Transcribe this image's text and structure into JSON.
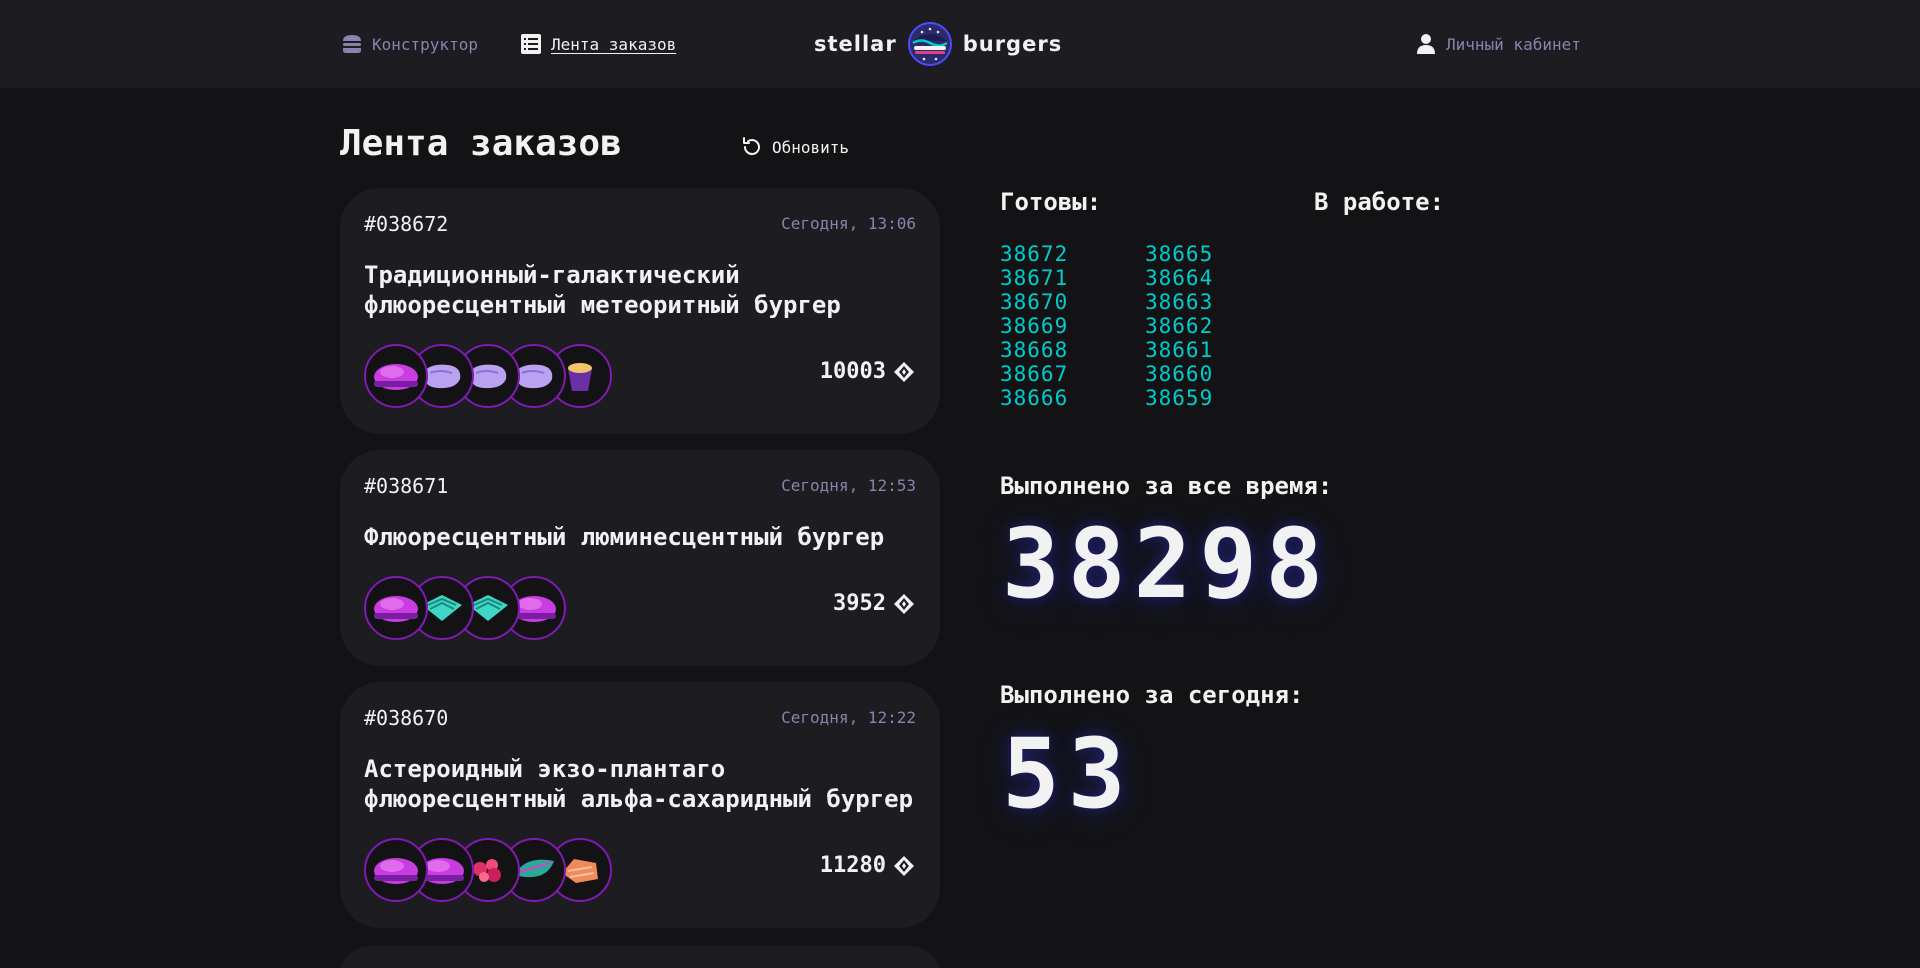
{
  "header": {
    "nav_constructor": "Конструктор",
    "nav_feed": "Лента заказов",
    "logo_left": "stellar",
    "logo_right": "burgers",
    "nav_profile": "Личный кабинет"
  },
  "main": {
    "title": "Лента заказов",
    "refresh_label": "Обновить"
  },
  "orders": [
    {
      "number": "#038672",
      "date": "Сегодня, 13:06",
      "name": "Традиционный-галактический флюоресцентный метеоритный бургер",
      "price": "10003",
      "ingredients": [
        "bun-purple",
        "meat-purple",
        "meat-purple",
        "meat-purple",
        "sauce-cup"
      ]
    },
    {
      "number": "#038671",
      "date": "Сегодня, 12:53",
      "name": "Флюоресцентный люминесцентный бургер",
      "price": "3952",
      "ingredients": [
        "bun-purple",
        "teal-bar",
        "teal-bar",
        "bun-purple"
      ]
    },
    {
      "number": "#038670",
      "date": "Сегодня, 12:22",
      "name": "Астероидный экзо-плантаго флюоресцентный альфа-сахаридный бургер",
      "price": "11280",
      "ingredients": [
        "bun-purple",
        "bun-purple",
        "red-bits",
        "teal-leaf",
        "orange-fillet"
      ]
    }
  ],
  "stats": {
    "ready_title": "Готовы:",
    "in_work_title": "В работе:",
    "ready_col1": [
      "38672",
      "38671",
      "38670",
      "38669",
      "38668",
      "38667",
      "38666"
    ],
    "ready_col2": [
      "38665",
      "38664",
      "38663",
      "38662",
      "38661",
      "38660",
      "38659"
    ],
    "total_title": "Выполнено за все время:",
    "total_value": "38298",
    "today_title": "Выполнено за сегодня:",
    "today_value": "53"
  },
  "colors": {
    "background": "#131316",
    "panel": "#1c1c21",
    "accent_ready": "#00cccc",
    "muted": "#8585ad",
    "ingredient_border": "#801ab2"
  }
}
